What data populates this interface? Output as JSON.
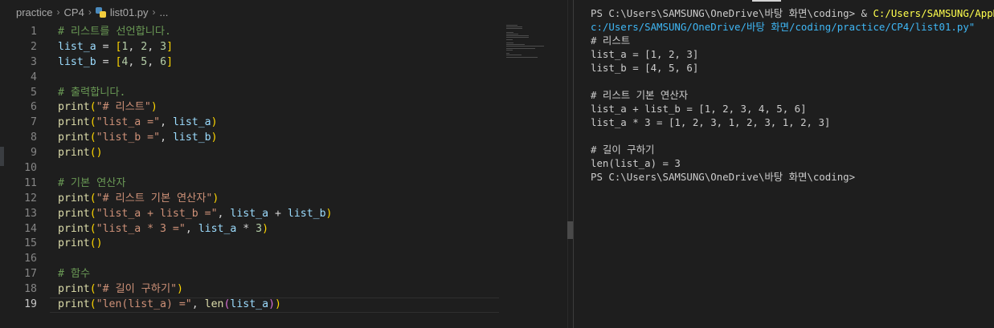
{
  "breadcrumb": {
    "items": [
      "practice",
      "CP4",
      "list01.py",
      "..."
    ],
    "separator": "›"
  },
  "editor": {
    "current_line": 19,
    "lines": [
      {
        "n": "1",
        "tokens": [
          {
            "c": "t-comment",
            "t": "# 리스트를 선언합니다."
          }
        ]
      },
      {
        "n": "2",
        "tokens": [
          {
            "c": "t-var",
            "t": "list_a"
          },
          {
            "c": "t-plain",
            "t": " = "
          },
          {
            "c": "t-p1",
            "t": "["
          },
          {
            "c": "t-num",
            "t": "1"
          },
          {
            "c": "t-plain",
            "t": ", "
          },
          {
            "c": "t-num",
            "t": "2"
          },
          {
            "c": "t-plain",
            "t": ", "
          },
          {
            "c": "t-num",
            "t": "3"
          },
          {
            "c": "t-p1",
            "t": "]"
          }
        ]
      },
      {
        "n": "3",
        "tokens": [
          {
            "c": "t-var",
            "t": "list_b"
          },
          {
            "c": "t-plain",
            "t": " = "
          },
          {
            "c": "t-p1",
            "t": "["
          },
          {
            "c": "t-num",
            "t": "4"
          },
          {
            "c": "t-plain",
            "t": ", "
          },
          {
            "c": "t-num",
            "t": "5"
          },
          {
            "c": "t-plain",
            "t": ", "
          },
          {
            "c": "t-num",
            "t": "6"
          },
          {
            "c": "t-p1",
            "t": "]"
          }
        ]
      },
      {
        "n": "4",
        "tokens": []
      },
      {
        "n": "5",
        "tokens": [
          {
            "c": "t-comment",
            "t": "# 출력합니다."
          }
        ]
      },
      {
        "n": "6",
        "tokens": [
          {
            "c": "t-func",
            "t": "print"
          },
          {
            "c": "t-p1",
            "t": "("
          },
          {
            "c": "t-string",
            "t": "\"# 리스트\""
          },
          {
            "c": "t-p1",
            "t": ")"
          }
        ]
      },
      {
        "n": "7",
        "tokens": [
          {
            "c": "t-func",
            "t": "print"
          },
          {
            "c": "t-p1",
            "t": "("
          },
          {
            "c": "t-string",
            "t": "\"list_a =\""
          },
          {
            "c": "t-plain",
            "t": ", "
          },
          {
            "c": "t-var",
            "t": "list_a"
          },
          {
            "c": "t-p1",
            "t": ")"
          }
        ]
      },
      {
        "n": "8",
        "tokens": [
          {
            "c": "t-func",
            "t": "print"
          },
          {
            "c": "t-p1",
            "t": "("
          },
          {
            "c": "t-string",
            "t": "\"list_b =\""
          },
          {
            "c": "t-plain",
            "t": ", "
          },
          {
            "c": "t-var",
            "t": "list_b"
          },
          {
            "c": "t-p1",
            "t": ")"
          }
        ]
      },
      {
        "n": "9",
        "tokens": [
          {
            "c": "t-func",
            "t": "print"
          },
          {
            "c": "t-p1",
            "t": "()"
          }
        ]
      },
      {
        "n": "10",
        "tokens": []
      },
      {
        "n": "11",
        "tokens": [
          {
            "c": "t-comment",
            "t": "# 기본 연산자"
          }
        ]
      },
      {
        "n": "12",
        "tokens": [
          {
            "c": "t-func",
            "t": "print"
          },
          {
            "c": "t-p1",
            "t": "("
          },
          {
            "c": "t-string",
            "t": "\"# 리스트 기본 연산자\""
          },
          {
            "c": "t-p1",
            "t": ")"
          }
        ]
      },
      {
        "n": "13",
        "tokens": [
          {
            "c": "t-func",
            "t": "print"
          },
          {
            "c": "t-p1",
            "t": "("
          },
          {
            "c": "t-string",
            "t": "\"list_a + list_b =\""
          },
          {
            "c": "t-plain",
            "t": ", "
          },
          {
            "c": "t-var",
            "t": "list_a"
          },
          {
            "c": "t-plain",
            "t": " + "
          },
          {
            "c": "t-var",
            "t": "list_b"
          },
          {
            "c": "t-p1",
            "t": ")"
          }
        ]
      },
      {
        "n": "14",
        "tokens": [
          {
            "c": "t-func",
            "t": "print"
          },
          {
            "c": "t-p1",
            "t": "("
          },
          {
            "c": "t-string",
            "t": "\"list_a * 3 =\""
          },
          {
            "c": "t-plain",
            "t": ", "
          },
          {
            "c": "t-var",
            "t": "list_a"
          },
          {
            "c": "t-plain",
            "t": " * "
          },
          {
            "c": "t-num",
            "t": "3"
          },
          {
            "c": "t-p1",
            "t": ")"
          }
        ]
      },
      {
        "n": "15",
        "tokens": [
          {
            "c": "t-func",
            "t": "print"
          },
          {
            "c": "t-p1",
            "t": "()"
          }
        ]
      },
      {
        "n": "16",
        "tokens": []
      },
      {
        "n": "17",
        "tokens": [
          {
            "c": "t-comment",
            "t": "# 함수"
          }
        ]
      },
      {
        "n": "18",
        "tokens": [
          {
            "c": "t-func",
            "t": "print"
          },
          {
            "c": "t-p1",
            "t": "("
          },
          {
            "c": "t-string",
            "t": "\"# 길이 구하기\""
          },
          {
            "c": "t-p1",
            "t": ")"
          }
        ]
      },
      {
        "n": "19",
        "tokens": [
          {
            "c": "t-func",
            "t": "print"
          },
          {
            "c": "t-p1",
            "t": "("
          },
          {
            "c": "t-string",
            "t": "\"len(list_a) =\""
          },
          {
            "c": "t-plain",
            "t": ", "
          },
          {
            "c": "t-func",
            "t": "len"
          },
          {
            "c": "t-p2",
            "t": "("
          },
          {
            "c": "t-var",
            "t": "list_a"
          },
          {
            "c": "t-p2",
            "t": ")"
          },
          {
            "c": "t-p1",
            "t": ")"
          }
        ]
      }
    ]
  },
  "terminal": {
    "lines": [
      {
        "tokens": [
          {
            "c": "ps",
            "t": "PS C:\\Users\\SAMSUNG\\OneDrive\\바탕 화면\\coding> & "
          },
          {
            "c": "cmd",
            "t": "C:/Users/SAMSUNG/AppData"
          }
        ]
      },
      {
        "tokens": [
          {
            "c": "path",
            "t": "c:/Users/SAMSUNG/OneDrive/바탕 화면/coding/practice/CP4/list01.py\""
          }
        ]
      },
      {
        "tokens": [
          {
            "c": "ps",
            "t": "# 리스트"
          }
        ]
      },
      {
        "tokens": [
          {
            "c": "ps",
            "t": "list_a = [1, 2, 3]"
          }
        ]
      },
      {
        "tokens": [
          {
            "c": "ps",
            "t": "list_b = [4, 5, 6]"
          }
        ]
      },
      {
        "tokens": []
      },
      {
        "tokens": [
          {
            "c": "ps",
            "t": "# 리스트 기본 연산자"
          }
        ]
      },
      {
        "tokens": [
          {
            "c": "ps",
            "t": "list_a + list_b = [1, 2, 3, 4, 5, 6]"
          }
        ]
      },
      {
        "tokens": [
          {
            "c": "ps",
            "t": "list_a * 3 = [1, 2, 3, 1, 2, 3, 1, 2, 3]"
          }
        ]
      },
      {
        "tokens": []
      },
      {
        "tokens": [
          {
            "c": "ps",
            "t": "# 길이 구하기"
          }
        ]
      },
      {
        "tokens": [
          {
            "c": "ps",
            "t": "len(list_a) = 3"
          }
        ]
      },
      {
        "tokens": [
          {
            "c": "ps",
            "t": "PS C:\\Users\\SAMSUNG\\OneDrive\\바탕 화면\\coding>"
          }
        ]
      }
    ]
  }
}
